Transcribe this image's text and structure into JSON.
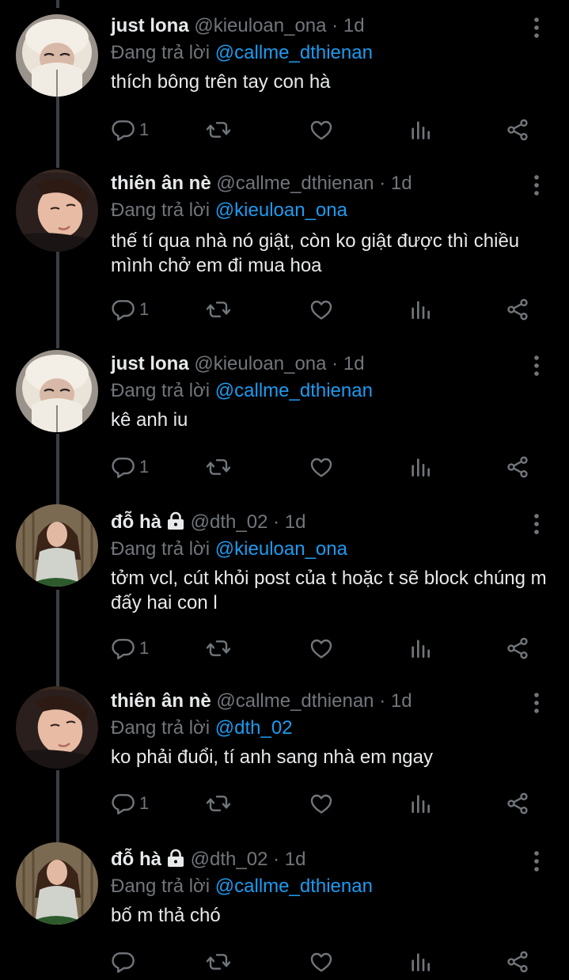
{
  "replying_prefix": "Đang trả lời",
  "colors": {
    "background": "#000000",
    "text": "#e7e9ea",
    "muted": "#71767b",
    "link": "#1d9bf0"
  },
  "tweets": [
    {
      "name": "just lona",
      "locked": false,
      "handle": "@kieuloan_ona",
      "sep": "·",
      "time": "1d",
      "reply_to": "@callme_dthienan",
      "text": "thích bông trên tay con hà",
      "reply_count": "1"
    },
    {
      "name": "thiên ân nè",
      "locked": false,
      "handle": "@callme_dthienan",
      "sep": "·",
      "time": "1d",
      "reply_to": "@kieuloan_ona",
      "text": "thế tí qua nhà nó giật, còn ko giật được thì chiều mình chở em đi mua hoa",
      "reply_count": "1"
    },
    {
      "name": "just lona",
      "locked": false,
      "handle": "@kieuloan_ona",
      "sep": "·",
      "time": "1d",
      "reply_to": "@callme_dthienan",
      "text": "kê anh iu",
      "reply_count": "1"
    },
    {
      "name": "đỗ hà",
      "locked": true,
      "handle": "@dth_02",
      "sep": "·",
      "time": "1d",
      "reply_to": "@kieuloan_ona",
      "text": "tởm vcl, cút khỏi post của t hoặc t sẽ block chúng m đấy hai con l",
      "reply_count": "1"
    },
    {
      "name": "thiên ân nè",
      "locked": false,
      "handle": "@callme_dthienan",
      "sep": "·",
      "time": "1d",
      "reply_to": "@dth_02",
      "text": "ko phải đuổi, tí anh sang nhà em ngay",
      "reply_count": "1"
    },
    {
      "name": "đỗ hà",
      "locked": true,
      "handle": "@dth_02",
      "sep": "·",
      "time": "1d",
      "reply_to": "@callme_dthienan",
      "text": "bố m thả chó",
      "reply_count": ""
    }
  ],
  "icons": {
    "reply": "reply-icon",
    "retweet": "retweet-icon",
    "like": "heart-icon",
    "views": "views-icon",
    "share": "share-icon",
    "more": "more-vertical-icon",
    "lock": "lock-icon"
  }
}
